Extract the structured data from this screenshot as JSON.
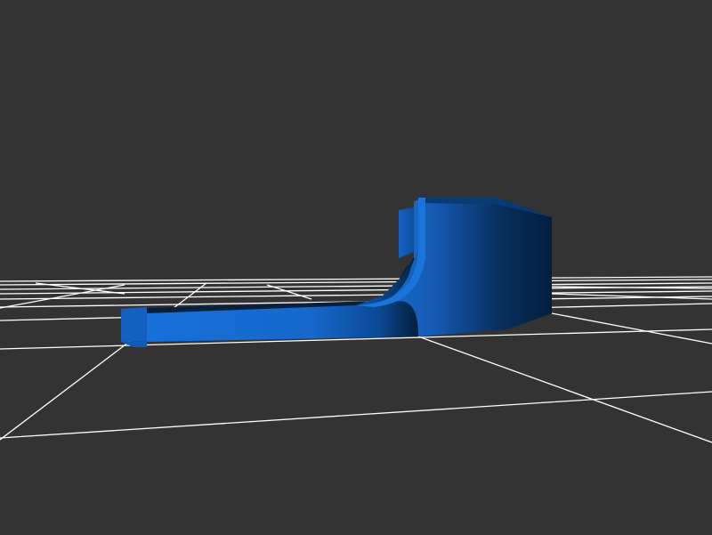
{
  "scene": {
    "background_color": "#333333",
    "grid_color": "#ffffff",
    "model_color": "#1565c0",
    "model_shadow_color": "#001a33",
    "model_dark_color": "#002244"
  }
}
